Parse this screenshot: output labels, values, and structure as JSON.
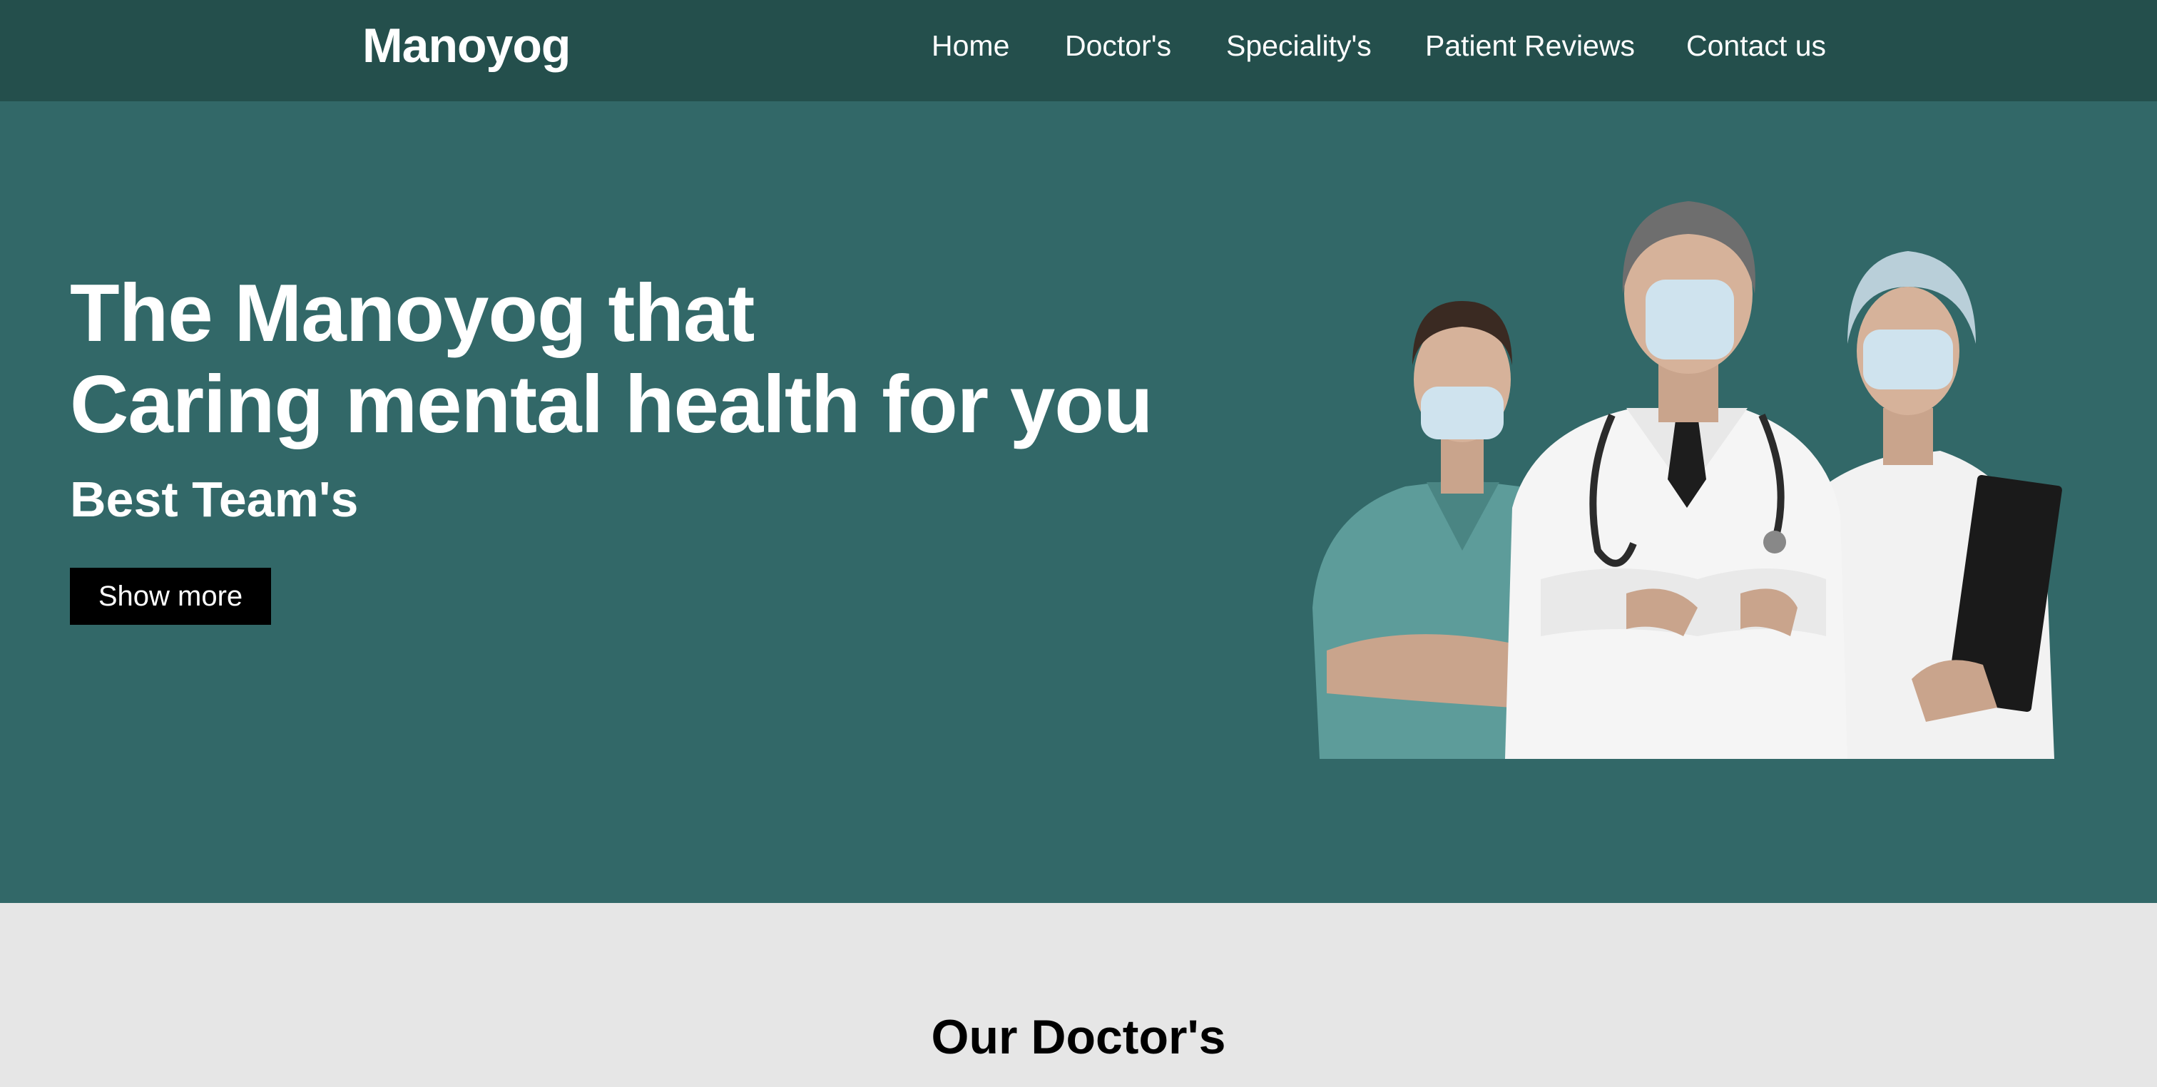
{
  "navbar": {
    "brand": "Manoyog",
    "links": [
      {
        "label": "Home"
      },
      {
        "label": "Doctor's"
      },
      {
        "label": "Speciality's"
      },
      {
        "label": "Patient Reviews"
      },
      {
        "label": "Contact us"
      }
    ]
  },
  "hero": {
    "title_line1": "The Manoyog that",
    "title_line2": "Caring mental health for you",
    "subtitle": "Best Team's",
    "button_label": "Show more",
    "image_icon": "medical-team-photo"
  },
  "doctors_section": {
    "title": "Our Doctor's"
  },
  "colors": {
    "navbar_bg": "#244f4c",
    "hero_bg": "#326868",
    "section_bg": "#e6e6e6",
    "button_bg": "#000000"
  }
}
